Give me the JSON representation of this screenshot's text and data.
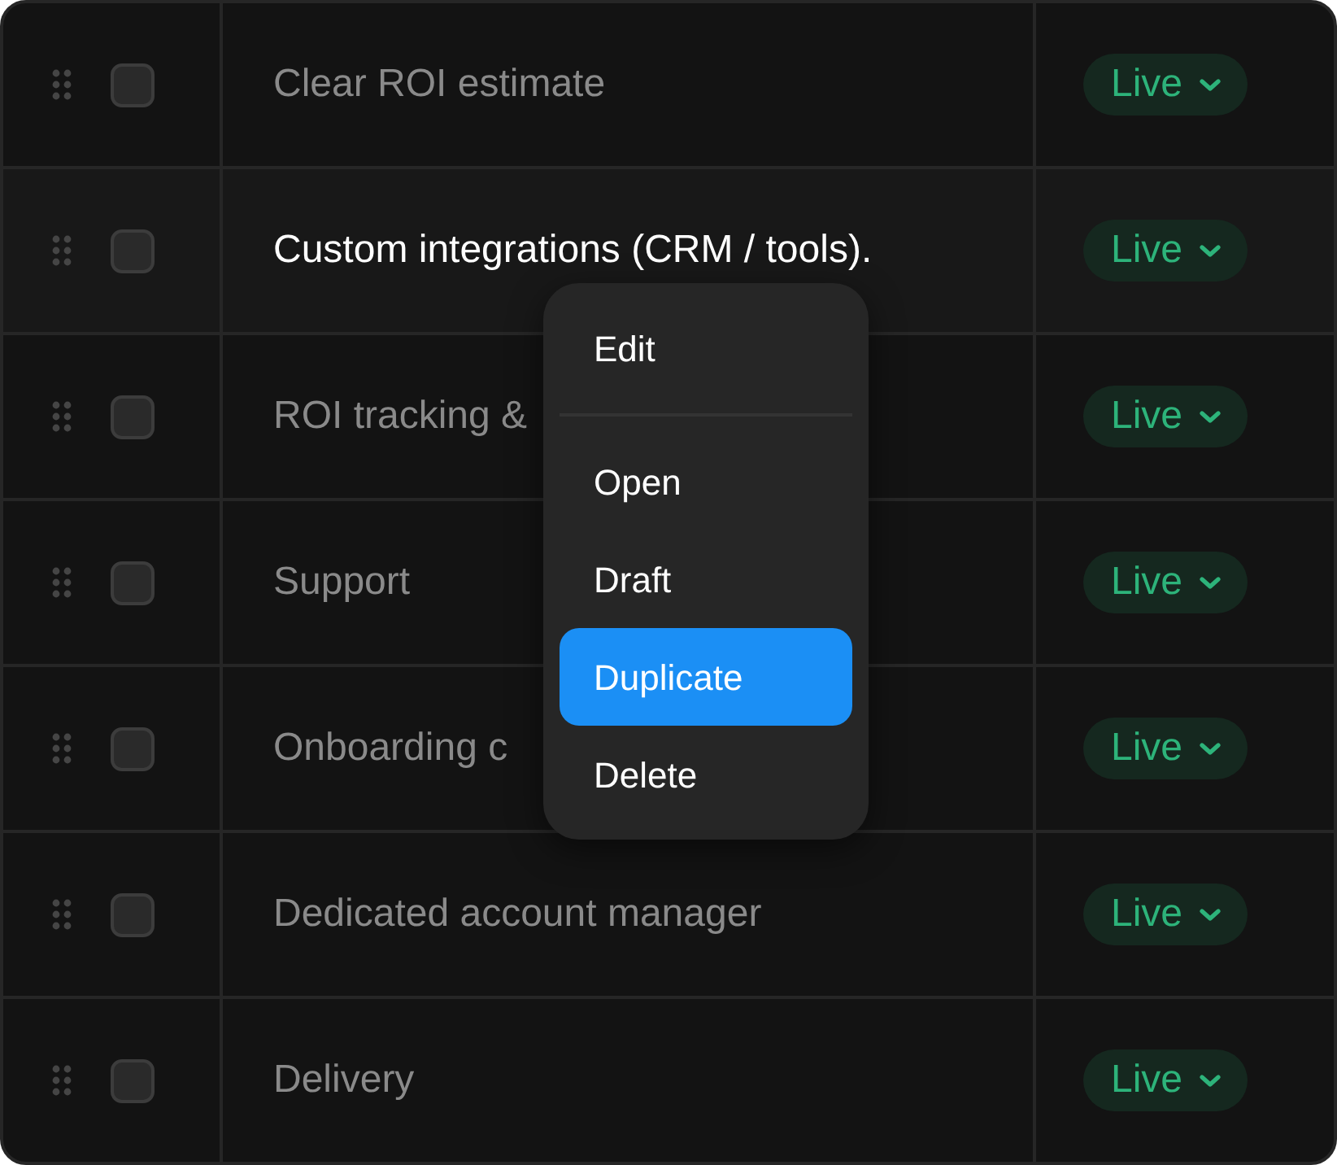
{
  "rows": [
    {
      "name": "Clear ROI estimate",
      "checked": false,
      "highlighted": false,
      "status": "Live"
    },
    {
      "name": "Custom integrations (CRM / tools).",
      "checked": false,
      "highlighted": true,
      "status": "Live"
    },
    {
      "name": "ROI tracking &",
      "checked": false,
      "highlighted": false,
      "status": "Live"
    },
    {
      "name": "Support",
      "checked": false,
      "highlighted": false,
      "status": "Live"
    },
    {
      "name": "Onboarding c",
      "checked": false,
      "highlighted": false,
      "status": "Live"
    },
    {
      "name": "Dedicated account manager",
      "checked": false,
      "highlighted": false,
      "status": "Live"
    },
    {
      "name": "Delivery",
      "checked": false,
      "highlighted": false,
      "status": "Live"
    }
  ],
  "context_menu": {
    "items": [
      {
        "kind": "item",
        "label": "Edit",
        "selected": false
      },
      {
        "kind": "separator"
      },
      {
        "kind": "item",
        "label": "Open",
        "selected": false
      },
      {
        "kind": "item",
        "label": "Draft",
        "selected": false
      },
      {
        "kind": "item",
        "label": "Duplicate",
        "selected": true
      },
      {
        "kind": "item",
        "label": "Delete",
        "selected": false
      }
    ]
  }
}
